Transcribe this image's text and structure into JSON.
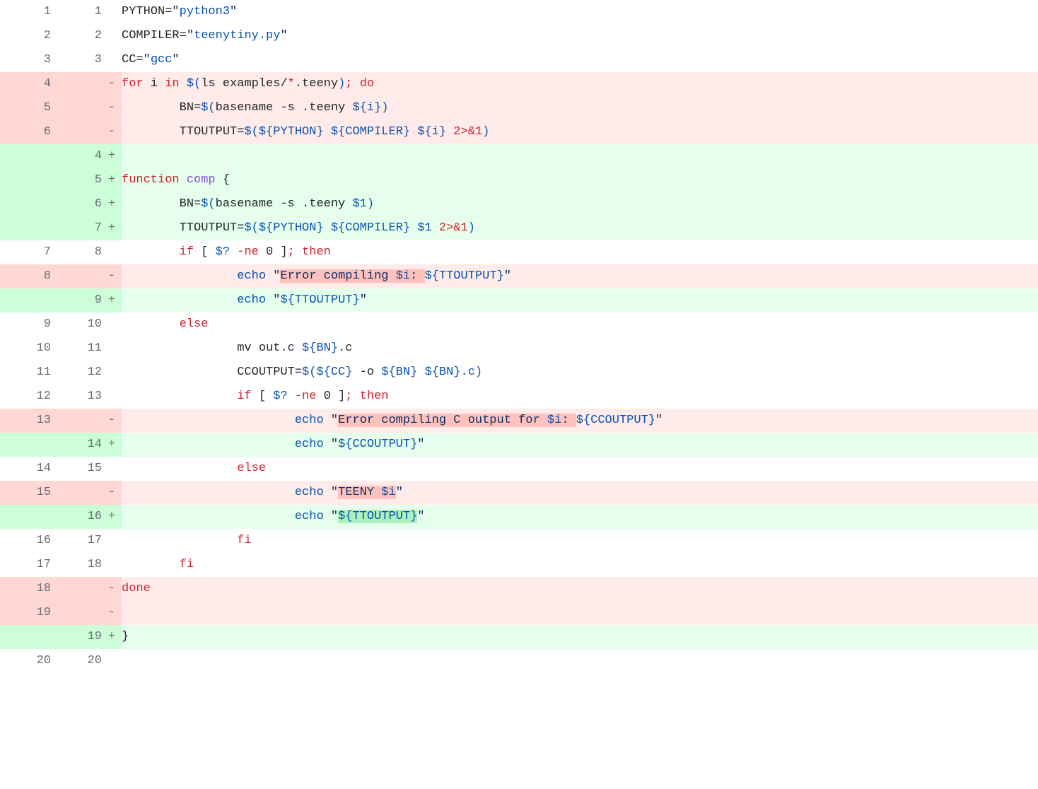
{
  "diff": {
    "lines": [
      {
        "type": "context",
        "oldNum": "1",
        "newNum": "1",
        "tokens": [
          {
            "t": "PYTHON=",
            "cls": "c-dark"
          },
          {
            "t": "\"",
            "cls": "c-str"
          },
          {
            "t": "python3",
            "cls": "c-ent"
          },
          {
            "t": "\"",
            "cls": "c-str"
          }
        ]
      },
      {
        "type": "context",
        "oldNum": "2",
        "newNum": "2",
        "tokens": [
          {
            "t": "COMPILER=",
            "cls": "c-dark"
          },
          {
            "t": "\"",
            "cls": "c-str"
          },
          {
            "t": "teenytiny.py",
            "cls": "c-ent"
          },
          {
            "t": "\"",
            "cls": "c-str"
          }
        ]
      },
      {
        "type": "context",
        "oldNum": "3",
        "newNum": "3",
        "tokens": [
          {
            "t": "CC=",
            "cls": "c-dark"
          },
          {
            "t": "\"",
            "cls": "c-str"
          },
          {
            "t": "gcc",
            "cls": "c-ent"
          },
          {
            "t": "\"",
            "cls": "c-str"
          }
        ]
      },
      {
        "type": "deletion",
        "oldNum": "4",
        "newNum": "",
        "tokens": [
          {
            "t": "for",
            "cls": "c-kw"
          },
          {
            "t": " i ",
            "cls": "c-dark"
          },
          {
            "t": "in",
            "cls": "c-kw"
          },
          {
            "t": " ",
            "cls": ""
          },
          {
            "t": "$(",
            "cls": "c-ent"
          },
          {
            "t": "ls examples/",
            "cls": "c-dark"
          },
          {
            "t": "*",
            "cls": "c-kw"
          },
          {
            "t": ".teeny",
            "cls": "c-dark"
          },
          {
            "t": ")",
            "cls": "c-ent"
          },
          {
            "t": ";",
            "cls": "c-kw"
          },
          {
            "t": " ",
            "cls": ""
          },
          {
            "t": "do",
            "cls": "c-kw"
          }
        ]
      },
      {
        "type": "deletion",
        "oldNum": "5",
        "newNum": "",
        "tokens": [
          {
            "t": "        BN=",
            "cls": "c-dark"
          },
          {
            "t": "$(",
            "cls": "c-ent"
          },
          {
            "t": "basename -s .teeny ",
            "cls": "c-dark"
          },
          {
            "t": "${i}",
            "cls": "c-ent"
          },
          {
            "t": ")",
            "cls": "c-ent"
          }
        ]
      },
      {
        "type": "deletion",
        "oldNum": "6",
        "newNum": "",
        "tokens": [
          {
            "t": "        TTOUTPUT=",
            "cls": "c-dark"
          },
          {
            "t": "$(${PYTHON}",
            "cls": "c-ent"
          },
          {
            "t": " ",
            "cls": ""
          },
          {
            "t": "${COMPILER}",
            "cls": "c-ent"
          },
          {
            "t": " ",
            "cls": ""
          },
          {
            "t": "${i}",
            "cls": "c-ent"
          },
          {
            "t": " ",
            "cls": ""
          },
          {
            "t": "2>&1",
            "cls": "c-kw"
          },
          {
            "t": ")",
            "cls": "c-ent"
          }
        ]
      },
      {
        "type": "addition",
        "oldNum": "",
        "newNum": "4",
        "tokens": []
      },
      {
        "type": "addition",
        "oldNum": "",
        "newNum": "5",
        "tokens": [
          {
            "t": "function",
            "cls": "c-kw"
          },
          {
            "t": " ",
            "cls": ""
          },
          {
            "t": "comp",
            "cls": "c-fn"
          },
          {
            "t": " {",
            "cls": "c-dark"
          }
        ]
      },
      {
        "type": "addition",
        "oldNum": "",
        "newNum": "6",
        "tokens": [
          {
            "t": "        BN=",
            "cls": "c-dark"
          },
          {
            "t": "$(",
            "cls": "c-ent"
          },
          {
            "t": "basename -s .teeny ",
            "cls": "c-dark"
          },
          {
            "t": "$1",
            "cls": "c-ent"
          },
          {
            "t": ")",
            "cls": "c-ent"
          }
        ]
      },
      {
        "type": "addition",
        "oldNum": "",
        "newNum": "7",
        "tokens": [
          {
            "t": "        TTOUTPUT=",
            "cls": "c-dark"
          },
          {
            "t": "$(${PYTHON}",
            "cls": "c-ent"
          },
          {
            "t": " ",
            "cls": ""
          },
          {
            "t": "${COMPILER}",
            "cls": "c-ent"
          },
          {
            "t": " ",
            "cls": ""
          },
          {
            "t": "$1",
            "cls": "c-ent"
          },
          {
            "t": " ",
            "cls": ""
          },
          {
            "t": "2>&1",
            "cls": "c-kw"
          },
          {
            "t": ")",
            "cls": "c-ent"
          }
        ]
      },
      {
        "type": "context",
        "oldNum": "7",
        "newNum": "8",
        "tokens": [
          {
            "t": "        ",
            "cls": ""
          },
          {
            "t": "if",
            "cls": "c-kw"
          },
          {
            "t": " [ ",
            "cls": "c-dark"
          },
          {
            "t": "$?",
            "cls": "c-ent"
          },
          {
            "t": " ",
            "cls": ""
          },
          {
            "t": "-ne",
            "cls": "c-kw"
          },
          {
            "t": " 0 ]",
            "cls": "c-dark"
          },
          {
            "t": ";",
            "cls": "c-kw"
          },
          {
            "t": " ",
            "cls": ""
          },
          {
            "t": "then",
            "cls": "c-kw"
          }
        ]
      },
      {
        "type": "deletion",
        "oldNum": "8",
        "newNum": "",
        "tokens": [
          {
            "t": "                ",
            "cls": ""
          },
          {
            "t": "echo",
            "cls": "c-builtin"
          },
          {
            "t": " ",
            "cls": ""
          },
          {
            "t": "\"",
            "cls": "c-str"
          },
          {
            "t": "Error compiling ",
            "cls": "c-str",
            "hl": "del"
          },
          {
            "t": "$i",
            "cls": "c-ent",
            "hl": "del"
          },
          {
            "t": ": ",
            "cls": "c-str",
            "hl": "del"
          },
          {
            "t": "${TTOUTPUT}",
            "cls": "c-ent"
          },
          {
            "t": "\"",
            "cls": "c-str"
          }
        ]
      },
      {
        "type": "addition",
        "oldNum": "",
        "newNum": "9",
        "tokens": [
          {
            "t": "                ",
            "cls": ""
          },
          {
            "t": "echo",
            "cls": "c-builtin"
          },
          {
            "t": " ",
            "cls": ""
          },
          {
            "t": "\"",
            "cls": "c-str"
          },
          {
            "t": "${TTOUTPUT}",
            "cls": "c-ent"
          },
          {
            "t": "\"",
            "cls": "c-str"
          }
        ]
      },
      {
        "type": "context",
        "oldNum": "9",
        "newNum": "10",
        "tokens": [
          {
            "t": "        ",
            "cls": ""
          },
          {
            "t": "else",
            "cls": "c-kw"
          }
        ]
      },
      {
        "type": "context",
        "oldNum": "10",
        "newNum": "11",
        "tokens": [
          {
            "t": "                mv out.c ",
            "cls": "c-dark"
          },
          {
            "t": "${BN}",
            "cls": "c-ent"
          },
          {
            "t": ".c",
            "cls": "c-dark"
          }
        ]
      },
      {
        "type": "context",
        "oldNum": "11",
        "newNum": "12",
        "tokens": [
          {
            "t": "                CCOUTPUT=",
            "cls": "c-dark"
          },
          {
            "t": "$(${CC}",
            "cls": "c-ent"
          },
          {
            "t": " -o ",
            "cls": "c-dark"
          },
          {
            "t": "${BN}",
            "cls": "c-ent"
          },
          {
            "t": " ",
            "cls": ""
          },
          {
            "t": "${BN}",
            "cls": "c-ent"
          },
          {
            "t": ".c",
            "cls": "c-ent"
          },
          {
            "t": ")",
            "cls": "c-ent"
          }
        ]
      },
      {
        "type": "context",
        "oldNum": "12",
        "newNum": "13",
        "tokens": [
          {
            "t": "                ",
            "cls": ""
          },
          {
            "t": "if",
            "cls": "c-kw"
          },
          {
            "t": " [ ",
            "cls": "c-dark"
          },
          {
            "t": "$?",
            "cls": "c-ent"
          },
          {
            "t": " ",
            "cls": ""
          },
          {
            "t": "-ne",
            "cls": "c-kw"
          },
          {
            "t": " 0 ]",
            "cls": "c-dark"
          },
          {
            "t": ";",
            "cls": "c-kw"
          },
          {
            "t": " ",
            "cls": ""
          },
          {
            "t": "then",
            "cls": "c-kw"
          }
        ]
      },
      {
        "type": "deletion",
        "oldNum": "13",
        "newNum": "",
        "tokens": [
          {
            "t": "                        ",
            "cls": ""
          },
          {
            "t": "echo",
            "cls": "c-builtin"
          },
          {
            "t": " ",
            "cls": ""
          },
          {
            "t": "\"",
            "cls": "c-str"
          },
          {
            "t": "Error compiling C output for ",
            "cls": "c-str",
            "hl": "del"
          },
          {
            "t": "$i",
            "cls": "c-ent",
            "hl": "del"
          },
          {
            "t": ": ",
            "cls": "c-str",
            "hl": "del"
          },
          {
            "t": "${CCOUTPUT}",
            "cls": "c-ent"
          },
          {
            "t": "\"",
            "cls": "c-str"
          }
        ]
      },
      {
        "type": "addition",
        "oldNum": "",
        "newNum": "14",
        "tokens": [
          {
            "t": "                        ",
            "cls": ""
          },
          {
            "t": "echo",
            "cls": "c-builtin"
          },
          {
            "t": " ",
            "cls": ""
          },
          {
            "t": "\"",
            "cls": "c-str"
          },
          {
            "t": "${CCOUTPUT}",
            "cls": "c-ent"
          },
          {
            "t": "\"",
            "cls": "c-str"
          }
        ]
      },
      {
        "type": "context",
        "oldNum": "14",
        "newNum": "15",
        "tokens": [
          {
            "t": "                ",
            "cls": ""
          },
          {
            "t": "else",
            "cls": "c-kw"
          }
        ]
      },
      {
        "type": "deletion",
        "oldNum": "15",
        "newNum": "",
        "tokens": [
          {
            "t": "                        ",
            "cls": ""
          },
          {
            "t": "echo",
            "cls": "c-builtin"
          },
          {
            "t": " ",
            "cls": ""
          },
          {
            "t": "\"",
            "cls": "c-str"
          },
          {
            "t": "TEENY ",
            "cls": "c-str",
            "hl": "del"
          },
          {
            "t": "$i",
            "cls": "c-ent",
            "hl": "del"
          },
          {
            "t": "\"",
            "cls": "c-str"
          }
        ]
      },
      {
        "type": "addition",
        "oldNum": "",
        "newNum": "16",
        "tokens": [
          {
            "t": "                        ",
            "cls": ""
          },
          {
            "t": "echo",
            "cls": "c-builtin"
          },
          {
            "t": " ",
            "cls": ""
          },
          {
            "t": "\"",
            "cls": "c-str"
          },
          {
            "t": "${TTOUTPUT}",
            "cls": "c-ent",
            "hl": "add"
          },
          {
            "t": "\"",
            "cls": "c-str"
          }
        ]
      },
      {
        "type": "context",
        "oldNum": "16",
        "newNum": "17",
        "tokens": [
          {
            "t": "                ",
            "cls": ""
          },
          {
            "t": "fi",
            "cls": "c-kw"
          }
        ]
      },
      {
        "type": "context",
        "oldNum": "17",
        "newNum": "18",
        "tokens": [
          {
            "t": "        ",
            "cls": ""
          },
          {
            "t": "fi",
            "cls": "c-kw"
          }
        ]
      },
      {
        "type": "deletion",
        "oldNum": "18",
        "newNum": "",
        "tokens": [
          {
            "t": "done",
            "cls": "c-kw"
          }
        ]
      },
      {
        "type": "deletion",
        "oldNum": "19",
        "newNum": "",
        "tokens": []
      },
      {
        "type": "addition",
        "oldNum": "",
        "newNum": "19",
        "tokens": [
          {
            "t": "}",
            "cls": "c-dark"
          }
        ]
      },
      {
        "type": "context",
        "oldNum": "20",
        "newNum": "20",
        "tokens": []
      }
    ]
  }
}
